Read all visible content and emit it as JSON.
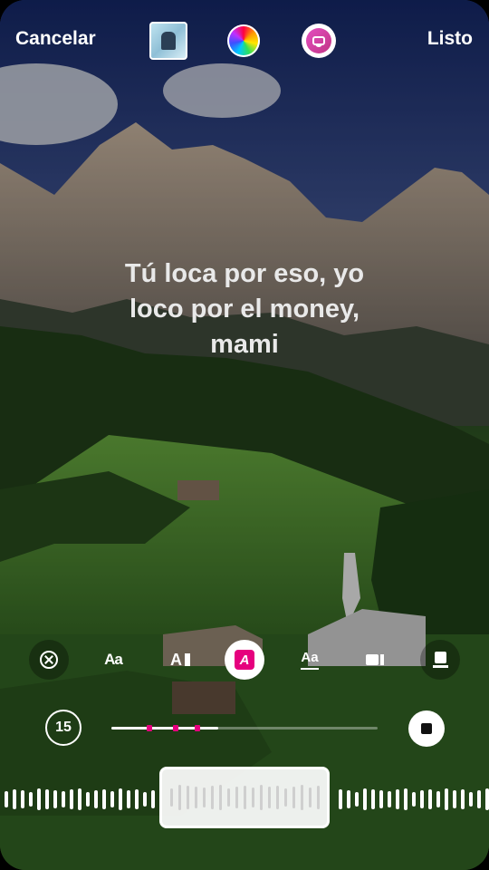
{
  "header": {
    "cancel_label": "Cancelar",
    "done_label": "Listo",
    "icons": [
      "album-art-thumbnail",
      "color-wheel-icon",
      "sticker-icon"
    ]
  },
  "lyrics": {
    "line1": "Tú loca por eso, yo",
    "line2": "loco por el money,",
    "line3": "mami"
  },
  "toolbar": {
    "styles": [
      "close-icon",
      "aa-lowercase",
      "ai-style",
      "a-badge-selected",
      "aa-underline",
      "camera-icon",
      "card-icon"
    ],
    "aa1": "Aa",
    "aa2": "A",
    "a_badge": "A",
    "aa3": "Aa"
  },
  "playback": {
    "duration_label": "15",
    "progress": 0.4,
    "accent_color": "#e6007e"
  }
}
